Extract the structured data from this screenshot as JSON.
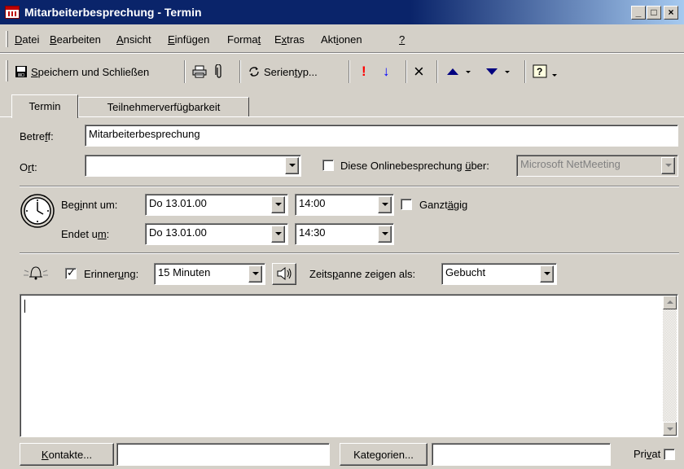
{
  "window": {
    "title": "Mitarbeiterbesprechung - Termin",
    "minimize": "_",
    "maximize": "□",
    "close": "×"
  },
  "menu": [
    {
      "pre": "",
      "u": "D",
      "post": "atei"
    },
    {
      "pre": "",
      "u": "B",
      "post": "earbeiten"
    },
    {
      "pre": "",
      "u": "A",
      "post": "nsicht"
    },
    {
      "pre": "",
      "u": "E",
      "post": "infügen"
    },
    {
      "pre": "Forma",
      "u": "t",
      "post": ""
    },
    {
      "pre": "E",
      "u": "x",
      "post": "tras"
    },
    {
      "pre": "Akt",
      "u": "i",
      "post": "onen"
    },
    {
      "pre": "",
      "u": "?",
      "post": ""
    }
  ],
  "toolbar": {
    "save_close": {
      "u": "S",
      "post": "peichern und Schließen"
    },
    "recurrence": {
      "pre": "Serien",
      "u": "t",
      "post": "yp..."
    },
    "importance_high": "!",
    "importance_low": "↓",
    "delete": "×"
  },
  "tabs": [
    {
      "label": "Termin",
      "active": true
    },
    {
      "label": "Teilnehmerverfügbarkeit",
      "active": false
    }
  ],
  "subject": {
    "pre": "Betre",
    "u": "f",
    "post": "f:",
    "value": "Mitarbeiterbesprechung"
  },
  "location": {
    "pre": "O",
    "u": "r",
    "post": "t:",
    "value": ""
  },
  "online_meeting": {
    "checked": false,
    "pre": "Diese Onlinebesprechung ",
    "u": "ü",
    "post": "ber:",
    "value": "Microsoft NetMeeting"
  },
  "start": {
    "pre": "Beg",
    "u": "i",
    "post": "nnt um:",
    "date": "Do 13.01.00",
    "time": "14:00"
  },
  "end": {
    "pre": "Endet u",
    "u": "m",
    "post": ":",
    "date": "Do 13.01.00",
    "time": "14:30"
  },
  "all_day": {
    "checked": false,
    "pre": "Ganzt",
    "u": "ä",
    "post": "gig"
  },
  "reminder": {
    "checked": true,
    "pre": "Erinner",
    "u": "u",
    "post": "ng:",
    "value": "15 Minuten"
  },
  "show_as": {
    "pre": "Zeits",
    "u": "p",
    "post": "anne zeigen als:",
    "value": "Gebucht"
  },
  "notes": {
    "value": ""
  },
  "footer": {
    "contacts": {
      "u": "K",
      "post": "ontakte..."
    },
    "contacts_value": "",
    "categories": {
      "pre": "Kate",
      "u": "g",
      "post": "orien..."
    },
    "categories_value": "",
    "private": {
      "pre": "Pri",
      "u": "v",
      "post": "at",
      "checked": false
    }
  },
  "colors": {
    "titlebar_start": "#0a246a",
    "titlebar_end": "#a6caf0",
    "face": "#d4d0c8",
    "importance_high": "#ff0000",
    "importance_low": "#0000ff"
  }
}
